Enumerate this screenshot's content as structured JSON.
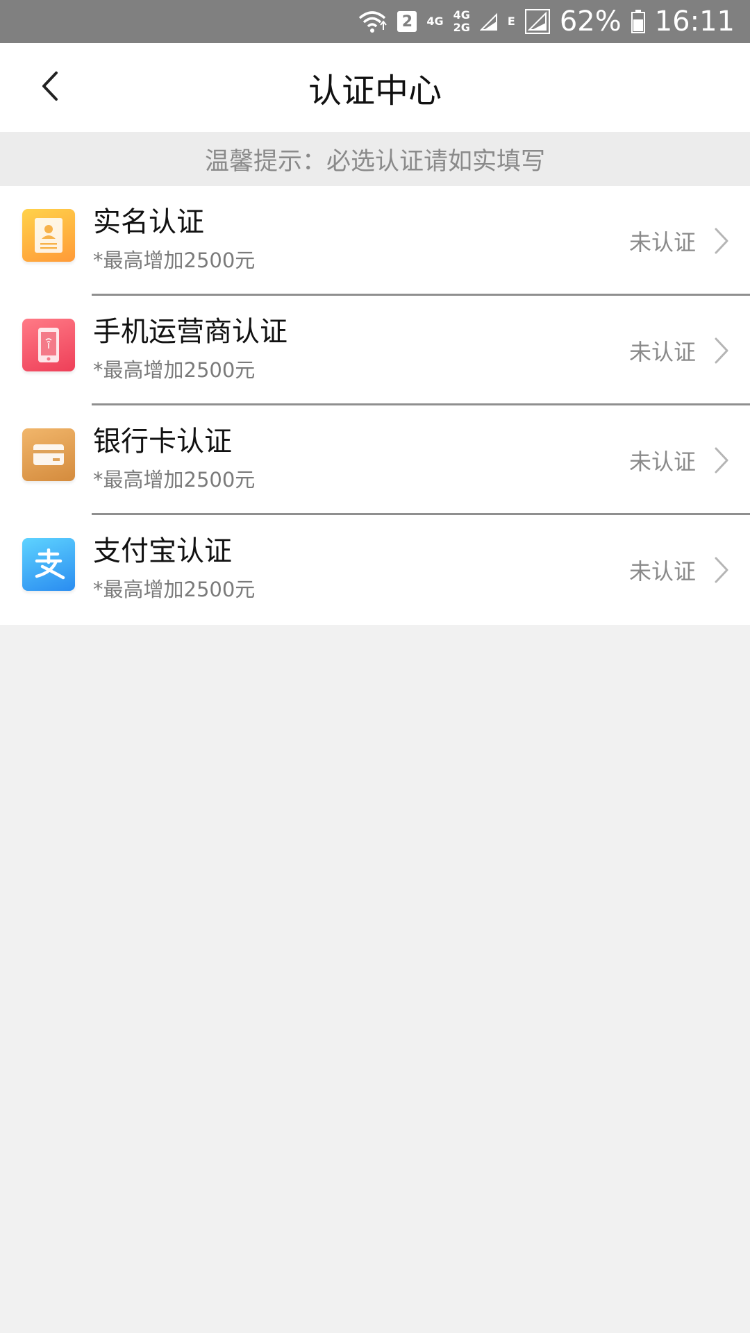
{
  "status_bar": {
    "sim_slot": "2",
    "net_top": "4G",
    "net_stack_top": "4G",
    "net_stack_bottom": "2G",
    "net_e": "E",
    "battery": "62%",
    "time": "16:11",
    "icons": [
      "wifi-icon",
      "signal-icon",
      "signal-icon",
      "battery-icon"
    ]
  },
  "header": {
    "title": "认证中心",
    "back_icon": "chevron-left-icon"
  },
  "notice": {
    "text": "温馨提示：必选认证请如实填写"
  },
  "items": [
    {
      "title": "实名认证",
      "subtitle": "*最高增加2500元",
      "status": "未认证",
      "icon": "id-card-icon",
      "icon_colors": [
        "#ffd24a",
        "#ff9d3a"
      ]
    },
    {
      "title": "手机运营商认证",
      "subtitle": "*最高增加2500元",
      "status": "未认证",
      "icon": "phone-icon",
      "icon_colors": [
        "#ff7a86",
        "#f0425a"
      ]
    },
    {
      "title": "银行卡认证",
      "subtitle": "*最高增加2500元",
      "status": "未认证",
      "icon": "bank-card-icon",
      "icon_colors": [
        "#f0b467",
        "#d89040"
      ]
    },
    {
      "title": "支付宝认证",
      "subtitle": "*最高增加2500元",
      "status": "未认证",
      "icon": "alipay-icon",
      "icon_colors": [
        "#5ed3ff",
        "#2a8ef0"
      ]
    }
  ]
}
